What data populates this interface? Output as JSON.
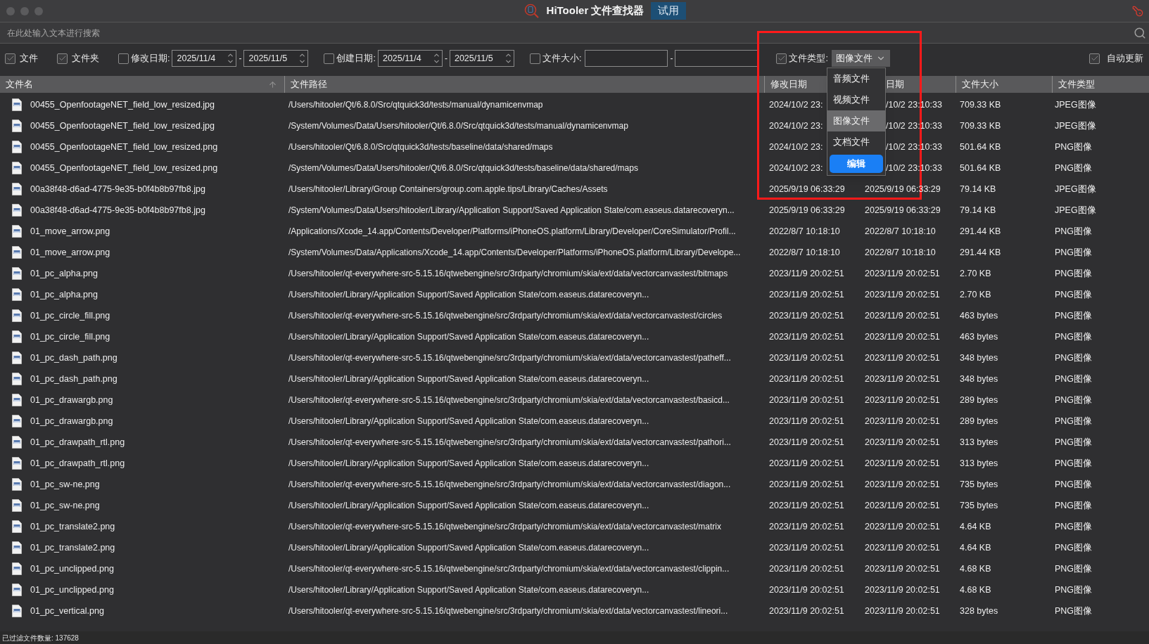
{
  "window": {
    "title": "HiTooler 文件查找器",
    "badge": "试用"
  },
  "search": {
    "placeholder": "在此处输入文本进行搜索"
  },
  "filters": [
    {
      "kind": "check",
      "label": "文件",
      "checked": true
    },
    {
      "kind": "check",
      "label": "文件夹",
      "checked": true
    },
    {
      "kind": "range",
      "label": "修改日期:",
      "checked": false,
      "from": "2025/11/4",
      "to": "2025/11/5",
      "separator": "-"
    },
    {
      "kind": "range",
      "label": "创建日期:",
      "checked": false,
      "from": "2025/11/4",
      "to": "2025/11/5",
      "separator": "-"
    },
    {
      "kind": "size",
      "label": "文件大小:",
      "checked": false,
      "separator": "-"
    },
    {
      "kind": "select",
      "label": "文件类型:",
      "checked": true,
      "value": "图像文件"
    }
  ],
  "auto_update": {
    "label": "自动更新",
    "checked": true
  },
  "type_menu": {
    "items": [
      {
        "label": "音频文件",
        "selected": false
      },
      {
        "label": "视频文件",
        "selected": false
      },
      {
        "label": "图像文件",
        "selected": true
      },
      {
        "label": "文档文件",
        "selected": false
      }
    ],
    "button": "编辑"
  },
  "table": {
    "columns": [
      {
        "label": "文件名",
        "sorted": true
      },
      {
        "label": "文件路径"
      },
      {
        "label": "修改日期"
      },
      {
        "label": "日期",
        "under_menu": true
      },
      {
        "label": "文件大小"
      },
      {
        "label": "文件类型"
      }
    ],
    "rows": [
      {
        "name": "00455_OpenfootageNET_field_low_resized.jpg",
        "path": "/Users/hitooler/Qt/6.8.0/Src/qtquick3d/tests/manual/dynamicenvmap",
        "modified": "2024/10/2 23:",
        "created": "/10/2 23:10:33",
        "size": "709.33 KB",
        "type": "JPEG图像",
        "under_menu": true
      },
      {
        "name": "00455_OpenfootageNET_field_low_resized.jpg",
        "path": "/System/Volumes/Data/Users/hitooler/Qt/6.8.0/Src/qtquick3d/tests/manual/dynamicenvmap",
        "modified": "2024/10/2 23:",
        "created": "/10/2 23:10:33",
        "size": "709.33 KB",
        "type": "JPEG图像",
        "under_menu": true
      },
      {
        "name": "00455_OpenfootageNET_field_low_resized.png",
        "path": "/Users/hitooler/Qt/6.8.0/Src/qtquick3d/tests/baseline/data/shared/maps",
        "modified": "2024/10/2 23:",
        "created": "/10/2 23:10:33",
        "size": "501.64 KB",
        "type": "PNG图像",
        "under_menu": true
      },
      {
        "name": "00455_OpenfootageNET_field_low_resized.png",
        "path": "/System/Volumes/Data/Users/hitooler/Qt/6.8.0/Src/qtquick3d/tests/baseline/data/shared/maps",
        "modified": "2024/10/2 23:",
        "created": "/10/2 23:10:33",
        "size": "501.64 KB",
        "type": "PNG图像",
        "under_menu": true
      },
      {
        "name": "00a38f48-d6ad-4775-9e35-b0f4b8b97fb8.jpg",
        "path": "/Users/hitooler/Library/Group Containers/group.com.apple.tips/Library/Caches/Assets",
        "modified": "2025/9/19 06:33:29",
        "created": "2025/9/19 06:33:29",
        "size": "79.14 KB",
        "type": "JPEG图像"
      },
      {
        "name": "00a38f48-d6ad-4775-9e35-b0f4b8b97fb8.jpg",
        "path": "/System/Volumes/Data/Users/hitooler/Library/Application Support/Saved Application State/com.easeus.datarecoveryn...",
        "modified": "2025/9/19 06:33:29",
        "created": "2025/9/19 06:33:29",
        "size": "79.14 KB",
        "type": "JPEG图像"
      },
      {
        "name": "01_move_arrow.png",
        "path": "/Applications/Xcode_14.app/Contents/Developer/Platforms/iPhoneOS.platform/Library/Developer/CoreSimulator/Profil...",
        "modified": "2022/8/7 10:18:10",
        "created": "2022/8/7 10:18:10",
        "size": "291.44 KB",
        "type": "PNG图像"
      },
      {
        "name": "01_move_arrow.png",
        "path": "/System/Volumes/Data/Applications/Xcode_14.app/Contents/Developer/Platforms/iPhoneOS.platform/Library/Develope...",
        "modified": "2022/8/7 10:18:10",
        "created": "2022/8/7 10:18:10",
        "size": "291.44 KB",
        "type": "PNG图像"
      },
      {
        "name": "01_pc_alpha.png",
        "path": "/Users/hitooler/qt-everywhere-src-5.15.16/qtwebengine/src/3rdparty/chromium/skia/ext/data/vectorcanvastest/bitmaps",
        "modified": "2023/11/9 20:02:51",
        "created": "2023/11/9 20:02:51",
        "size": "2.70 KB",
        "type": "PNG图像"
      },
      {
        "name": "01_pc_alpha.png",
        "path": "/Users/hitooler/Library/Application Support/Saved Application State/com.easeus.datarecoveryn...",
        "modified": "2023/11/9 20:02:51",
        "created": "2023/11/9 20:02:51",
        "size": "2.70 KB",
        "type": "PNG图像"
      },
      {
        "name": "01_pc_circle_fill.png",
        "path": "/Users/hitooler/qt-everywhere-src-5.15.16/qtwebengine/src/3rdparty/chromium/skia/ext/data/vectorcanvastest/circles",
        "modified": "2023/11/9 20:02:51",
        "created": "2023/11/9 20:02:51",
        "size": "463 bytes",
        "type": "PNG图像"
      },
      {
        "name": "01_pc_circle_fill.png",
        "path": "/Users/hitooler/Library/Application Support/Saved Application State/com.easeus.datarecoveryn...",
        "modified": "2023/11/9 20:02:51",
        "created": "2023/11/9 20:02:51",
        "size": "463 bytes",
        "type": "PNG图像"
      },
      {
        "name": "01_pc_dash_path.png",
        "path": "/Users/hitooler/qt-everywhere-src-5.15.16/qtwebengine/src/3rdparty/chromium/skia/ext/data/vectorcanvastest/patheff...",
        "modified": "2023/11/9 20:02:51",
        "created": "2023/11/9 20:02:51",
        "size": "348 bytes",
        "type": "PNG图像"
      },
      {
        "name": "01_pc_dash_path.png",
        "path": "/Users/hitooler/Library/Application Support/Saved Application State/com.easeus.datarecoveryn...",
        "modified": "2023/11/9 20:02:51",
        "created": "2023/11/9 20:02:51",
        "size": "348 bytes",
        "type": "PNG图像"
      },
      {
        "name": "01_pc_drawargb.png",
        "path": "/Users/hitooler/qt-everywhere-src-5.15.16/qtwebengine/src/3rdparty/chromium/skia/ext/data/vectorcanvastest/basicd...",
        "modified": "2023/11/9 20:02:51",
        "created": "2023/11/9 20:02:51",
        "size": "289 bytes",
        "type": "PNG图像"
      },
      {
        "name": "01_pc_drawargb.png",
        "path": "/Users/hitooler/Library/Application Support/Saved Application State/com.easeus.datarecoveryn...",
        "modified": "2023/11/9 20:02:51",
        "created": "2023/11/9 20:02:51",
        "size": "289 bytes",
        "type": "PNG图像"
      },
      {
        "name": "01_pc_drawpath_rtl.png",
        "path": "/Users/hitooler/qt-everywhere-src-5.15.16/qtwebengine/src/3rdparty/chromium/skia/ext/data/vectorcanvastest/pathori...",
        "modified": "2023/11/9 20:02:51",
        "created": "2023/11/9 20:02:51",
        "size": "313 bytes",
        "type": "PNG图像"
      },
      {
        "name": "01_pc_drawpath_rtl.png",
        "path": "/Users/hitooler/Library/Application Support/Saved Application State/com.easeus.datarecoveryn...",
        "modified": "2023/11/9 20:02:51",
        "created": "2023/11/9 20:02:51",
        "size": "313 bytes",
        "type": "PNG图像"
      },
      {
        "name": "01_pc_sw-ne.png",
        "path": "/Users/hitooler/qt-everywhere-src-5.15.16/qtwebengine/src/3rdparty/chromium/skia/ext/data/vectorcanvastest/diagon...",
        "modified": "2023/11/9 20:02:51",
        "created": "2023/11/9 20:02:51",
        "size": "735 bytes",
        "type": "PNG图像"
      },
      {
        "name": "01_pc_sw-ne.png",
        "path": "/Users/hitooler/Library/Application Support/Saved Application State/com.easeus.datarecoveryn...",
        "modified": "2023/11/9 20:02:51",
        "created": "2023/11/9 20:02:51",
        "size": "735 bytes",
        "type": "PNG图像"
      },
      {
        "name": "01_pc_translate2.png",
        "path": "/Users/hitooler/qt-everywhere-src-5.15.16/qtwebengine/src/3rdparty/chromium/skia/ext/data/vectorcanvastest/matrix",
        "modified": "2023/11/9 20:02:51",
        "created": "2023/11/9 20:02:51",
        "size": "4.64 KB",
        "type": "PNG图像"
      },
      {
        "name": "01_pc_translate2.png",
        "path": "/Users/hitooler/Library/Application Support/Saved Application State/com.easeus.datarecoveryn...",
        "modified": "2023/11/9 20:02:51",
        "created": "2023/11/9 20:02:51",
        "size": "4.64 KB",
        "type": "PNG图像"
      },
      {
        "name": "01_pc_unclipped.png",
        "path": "/Users/hitooler/qt-everywhere-src-5.15.16/qtwebengine/src/3rdparty/chromium/skia/ext/data/vectorcanvastest/clippin...",
        "modified": "2023/11/9 20:02:51",
        "created": "2023/11/9 20:02:51",
        "size": "4.68 KB",
        "type": "PNG图像"
      },
      {
        "name": "01_pc_unclipped.png",
        "path": "/Users/hitooler/Library/Application Support/Saved Application State/com.easeus.datarecoveryn...",
        "modified": "2023/11/9 20:02:51",
        "created": "2023/11/9 20:02:51",
        "size": "4.68 KB",
        "type": "PNG图像"
      },
      {
        "name": "01_pc_vertical.png",
        "path": "/Users/hitooler/qt-everywhere-src-5.15.16/qtwebengine/src/3rdparty/chromium/skia/ext/data/vectorcanvastest/lineori...",
        "modified": "2023/11/9 20:02:51",
        "created": "2023/11/9 20:02:51",
        "size": "328 bytes",
        "type": "PNG图像"
      }
    ]
  },
  "status_bar": {
    "text": "已过滤文件数量: 137628"
  }
}
